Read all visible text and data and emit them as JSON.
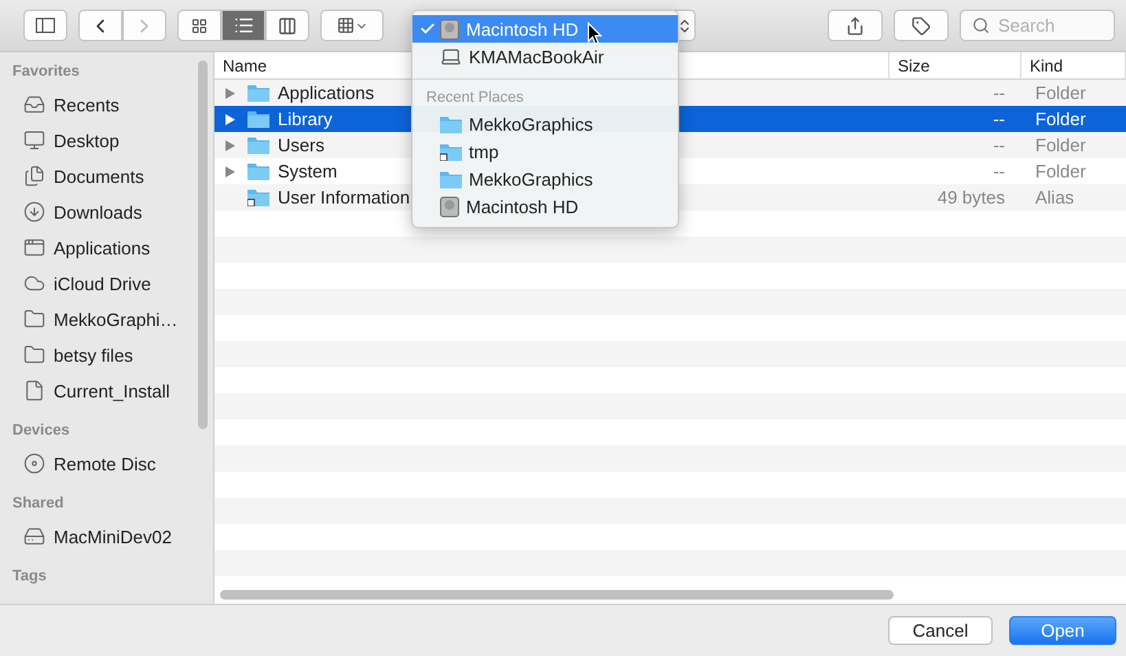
{
  "toolbar": {
    "view_modes": [
      {
        "kind": "icons",
        "selected": false
      },
      {
        "kind": "list",
        "selected": true
      },
      {
        "kind": "columns",
        "selected": false
      }
    ],
    "search": {
      "placeholder": "Search"
    }
  },
  "sidebar": {
    "sections": [
      {
        "title": "Favorites",
        "items": [
          {
            "label": "Recents",
            "kind": "recents"
          },
          {
            "label": "Desktop",
            "kind": "desktop"
          },
          {
            "label": "Documents",
            "kind": "documents"
          },
          {
            "label": "Downloads",
            "kind": "downloads"
          },
          {
            "label": "Applications",
            "kind": "applications"
          },
          {
            "label": "iCloud Drive",
            "kind": "cloud"
          },
          {
            "label": "MekkoGraphi…",
            "kind": "folder"
          },
          {
            "label": "betsy files",
            "kind": "folder"
          },
          {
            "label": "Current_Install",
            "kind": "file"
          }
        ]
      },
      {
        "title": "Devices",
        "items": [
          {
            "label": "Remote Disc",
            "kind": "disc"
          }
        ]
      },
      {
        "title": "Shared",
        "items": [
          {
            "label": "MacMiniDev02",
            "kind": "server"
          }
        ]
      },
      {
        "title": "Tags"
      }
    ]
  },
  "table": {
    "columns": [
      "Name",
      "Size",
      "Kind"
    ],
    "rows": [
      {
        "name": "Applications",
        "size": "--",
        "kind": "Folder",
        "expandable": true,
        "selected": false
      },
      {
        "name": "Library",
        "size": "--",
        "kind": "Folder",
        "expandable": true,
        "selected": true
      },
      {
        "name": "Users",
        "size": "--",
        "kind": "Folder",
        "expandable": true,
        "selected": false
      },
      {
        "name": "System",
        "size": "--",
        "kind": "Folder",
        "expandable": true,
        "selected": false
      },
      {
        "name": "User Information",
        "size": "49 bytes",
        "kind": "Alias",
        "expandable": false,
        "selected": false
      }
    ]
  },
  "location_menu": {
    "items": [
      {
        "label": "Macintosh HD",
        "kind": "disk",
        "selected": true
      },
      {
        "label": "KMAMacBookAir",
        "kind": "laptop",
        "selected": false
      }
    ],
    "recent_title": "Recent Places",
    "recent": [
      {
        "label": "MekkoGraphics",
        "kind": "folder"
      },
      {
        "label": "tmp",
        "kind": "alias"
      },
      {
        "label": "MekkoGraphics",
        "kind": "folder"
      },
      {
        "label": "Macintosh HD",
        "kind": "disk"
      }
    ]
  },
  "buttons": [
    {
      "label": "Cancel",
      "kind": "default"
    },
    {
      "label": "Open",
      "kind": "primary"
    }
  ]
}
